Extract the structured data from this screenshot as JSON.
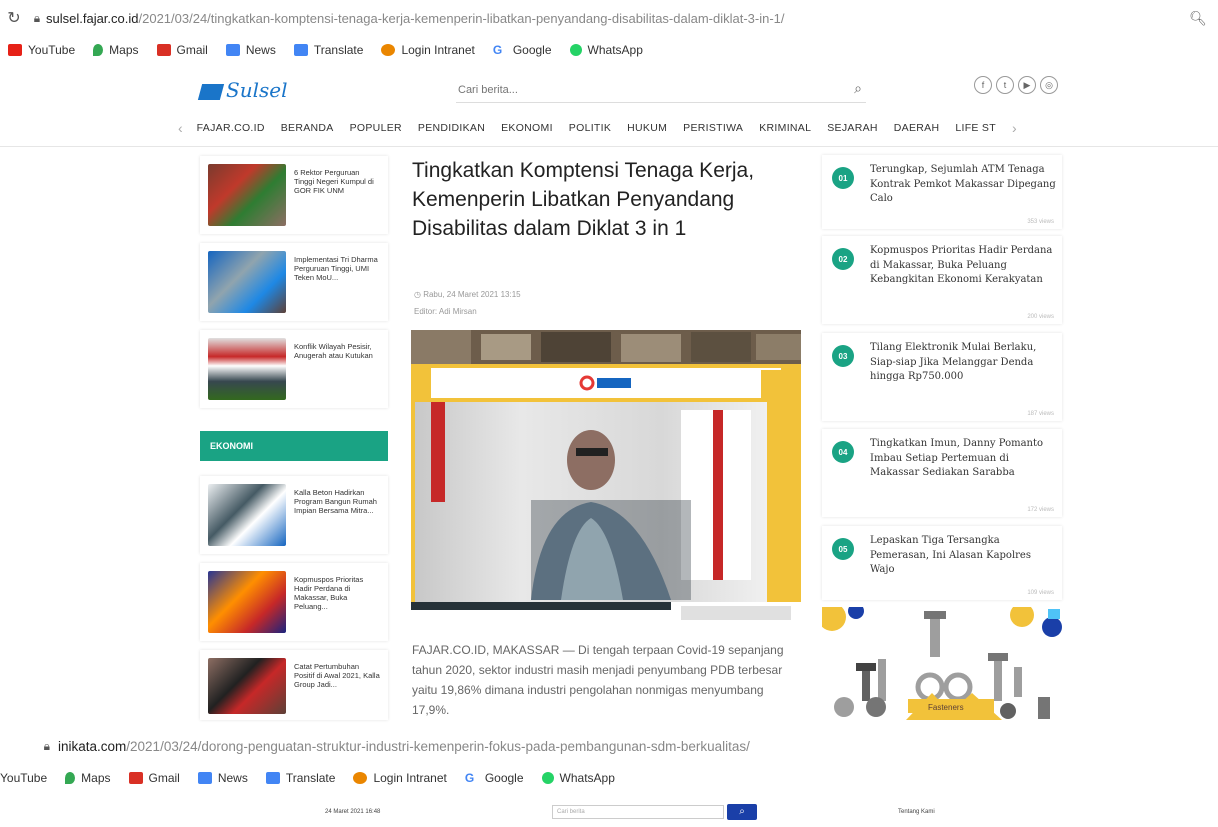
{
  "browser_top": {
    "reload_icon": "reload-icon",
    "url_domain": "sulsel.fajar.co.id",
    "url_path": "/2021/03/24/tingkatkan-komptensi-tenaga-kerja-kemenperin-libatkan-penyandang-disabilitas-dalam-diklat-3-in-1/",
    "bookmarks": [
      "YouTube",
      "Maps",
      "Gmail",
      "News",
      "Translate",
      "Login Intranet",
      "Google",
      "WhatsApp"
    ]
  },
  "site": {
    "logo_text": "Sulsel",
    "search_placeholder": "Cari berita...",
    "nav": [
      "FAJAR.CO.ID",
      "BERANDA",
      "POPULER",
      "PENDIDIKAN",
      "EKONOMI",
      "POLITIK",
      "HUKUM",
      "PERISTIWA",
      "KRIMINAL",
      "SEJARAH",
      "DAERAH",
      "LIFE ST"
    ]
  },
  "left_cards": [
    {
      "title": "6 Rektor Perguruan Tinggi Negeri Kumpul di GOR FIK UNM"
    },
    {
      "title": "Implementasi Tri Dharma Perguruan Tinggi, UMI Teken MoU..."
    },
    {
      "title": "Konflik Wilayah Pesisir, Anugerah atau Kutukan"
    }
  ],
  "section_label": "EKONOMI",
  "ekonomi_cards": [
    {
      "title": "Kalla Beton Hadirkan Program Bangun Rumah Impian Bersama Mitra..."
    },
    {
      "title": "Kopmuspos Prioritas Hadir Perdana di Makassar, Buka Peluang..."
    },
    {
      "title": "Catat Pertumbuhan Positif di Awal 2021, Kalla Group Jadi..."
    }
  ],
  "article": {
    "title": "Tingkatkan Komptensi Tenaga Kerja, Kemenperin Libatkan Penyandang Disabilitas dalam Diklat 3 in 1",
    "date": "Rabu, 24 Maret 2021 13:15",
    "editor": "Editor: Adi Mirsan",
    "lead": "FAJAR.CO.ID, MAKASSAR — Di tengah terpaan Covid-19 sepanjang tahun 2020, sektor industri masih menjadi penyumbang PDB terbesar yaitu 19,86% dimana industri pengolahan nonmigas menyumbang 17,9%."
  },
  "popular": [
    {
      "num": "01",
      "title": "Terungkap, Sejumlah ATM Tenaga Kontrak Pemkot Makassar Dipegang Calo",
      "views": "353 views"
    },
    {
      "num": "02",
      "title": "Kopmuspos Prioritas Hadir Perdana di Makassar, Buka Peluang Kebangkitan Ekonomi Kerakyatan",
      "views": "200 views"
    },
    {
      "num": "03",
      "title": "Tilang Elektronik Mulai Berlaku, Siap-siap Jika Melanggar Denda hingga Rp750.000",
      "views": "187 views"
    },
    {
      "num": "04",
      "title": "Tingkatkan Imun, Danny Pomanto Imbau Setiap Pertemuan di Makassar Sediakan Sarabba",
      "views": "172 views"
    },
    {
      "num": "05",
      "title": "Lepaskan Tiga Tersangka Pemerasan, Ini Alasan Kapolres Wajo",
      "views": "109 views"
    }
  ],
  "ad": {
    "label": "Fasteners"
  },
  "browser_bottom": {
    "url_domain": "inikata.com",
    "url_path": "/2021/03/24/dorong-penguatan-struktur-industri-kemenperin-fokus-pada-pembangunan-sdm-berkualitas/",
    "bookmarks": [
      "YouTube",
      "Maps",
      "Gmail",
      "News",
      "Translate",
      "Login Intranet",
      "Google",
      "WhatsApp"
    ],
    "date": "24 Maret 2021 16:48",
    "search_placeholder": "Cari berita",
    "about": "Tentang Kami"
  },
  "colors": {
    "accent": "#1aa384",
    "brand": "#1a75c9",
    "hero": "#f2c23a"
  }
}
